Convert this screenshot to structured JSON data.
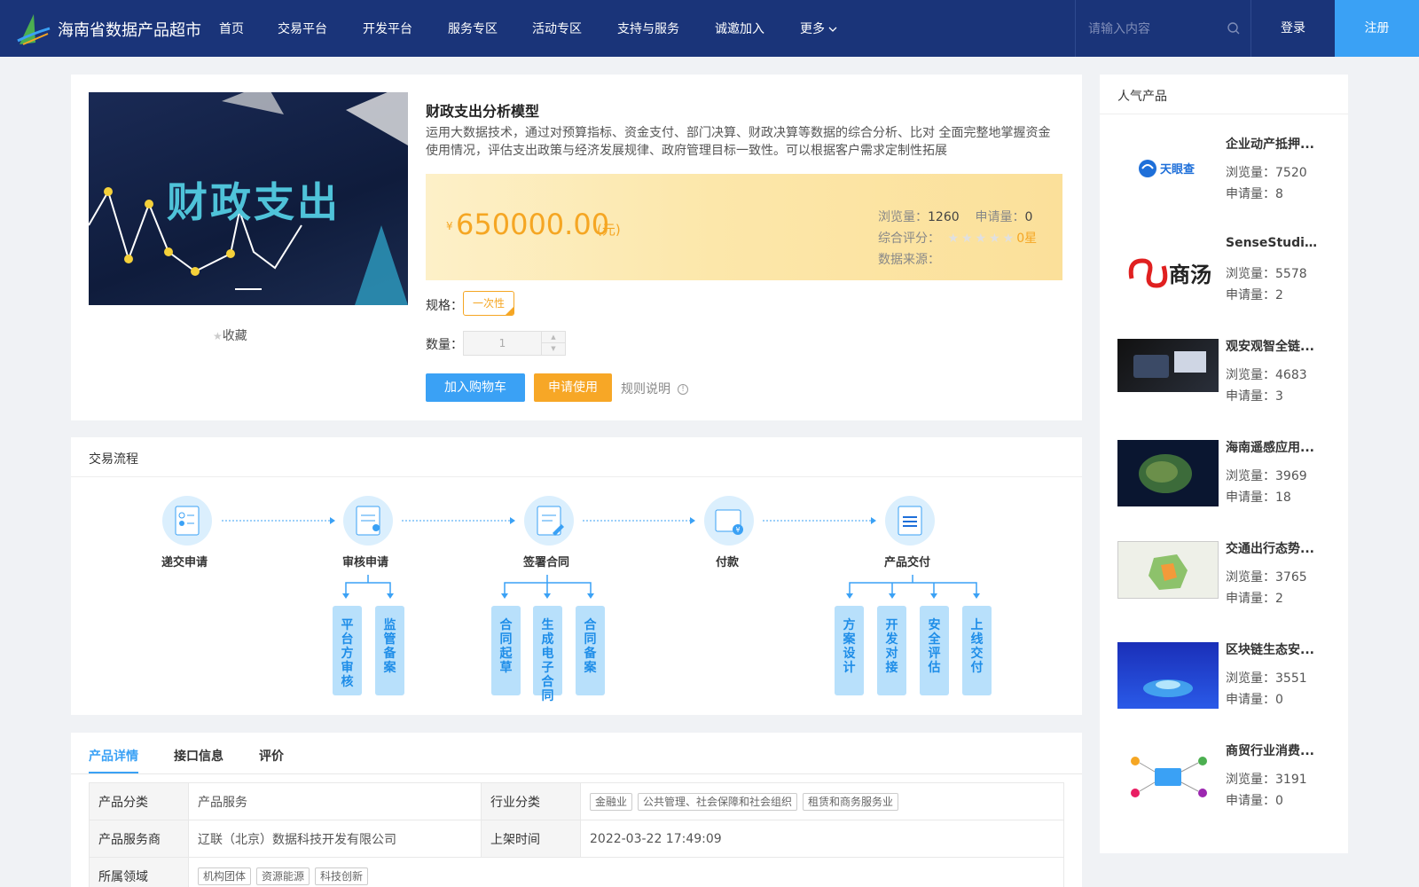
{
  "header": {
    "logo_text": "海南省数据产品超市",
    "nav": [
      "首页",
      "交易平台",
      "开发平台",
      "服务专区",
      "活动专区",
      "支持与服务",
      "诚邀加入",
      "更多"
    ],
    "search_placeholder": "请输入内容",
    "login": "登录",
    "register": "注册",
    "colors": {
      "bar": "#1a3479",
      "register": "#3aa1f5"
    }
  },
  "product": {
    "image_text": "财政支出",
    "favorite": "收藏",
    "title": "财政支出分析模型",
    "description": "运用大数据技术，通过对预算指标、资金支付、部门决算、财政决算等数据的综合分析、比对 全面完整地掌握资金使用情况，评估支出政策与经济发展规律、政府管理目标一致性。可以根据客户需求定制性拓展",
    "currency": "¥",
    "price": "650000.00",
    "price_unit": "(元)",
    "views_label": "浏览量：",
    "views": "1260",
    "applications_label": "申请量：",
    "applications": "0",
    "rating_label": "综合评分：",
    "rating_value": "0星",
    "rating_stars": 0,
    "source_label": "数据来源：",
    "spec_label": "规格：",
    "spec_option": "一次性",
    "qty_label": "数量：",
    "qty_value": "1",
    "add_to_cart": "加入购物车",
    "apply": "申请使用",
    "rules": "规则说明",
    "colors": {
      "accent": "#f5a623",
      "primary": "#3aa1f5"
    }
  },
  "process": {
    "title": "交易流程",
    "steps": [
      {
        "label": "递交申请",
        "icon": "form-icon"
      },
      {
        "label": "审核申请",
        "icon": "review-icon"
      },
      {
        "label": "签署合同",
        "icon": "contract-icon"
      },
      {
        "label": "付款",
        "icon": "payment-icon"
      },
      {
        "label": "产品交付",
        "icon": "delivery-icon"
      }
    ],
    "sub_steps": {
      "review": [
        "平台方审核",
        "监管备案"
      ],
      "contract": [
        "合同起草",
        "生成电子合同",
        "合同备案"
      ],
      "delivery": [
        "方案设计",
        "开发对接",
        "安全评估",
        "上线交付"
      ]
    }
  },
  "tabs": [
    "产品详情",
    "接口信息",
    "评价"
  ],
  "details": {
    "category_label": "产品分类",
    "category": "产品服务",
    "industry_label": "行业分类",
    "industry_tags": [
      "金融业",
      "公共管理、社会保障和社会组织",
      "租赁和商务服务业"
    ],
    "provider_label": "产品服务商",
    "provider": "辽联（北京）数据科技开发有限公司",
    "listed_label": "上架时间",
    "listed": "2022-03-22 17:49:09",
    "domain_label": "所属领域",
    "domain_tags": [
      "机构团体",
      "资源能源",
      "科技创新"
    ]
  },
  "sidebar": {
    "title": "人气产品",
    "views_label": "浏览量：",
    "apps_label": "申请量：",
    "items": [
      {
        "name": "企业动产抵押...",
        "views": "7520",
        "apps": "8",
        "logo": "天眼查"
      },
      {
        "name": "SenseStudio...",
        "views": "5578",
        "apps": "2",
        "logo": "商汤"
      },
      {
        "name": "观安观智全链...",
        "views": "4683",
        "apps": "3",
        "logo": ""
      },
      {
        "name": "海南遥感应用...",
        "views": "3969",
        "apps": "18",
        "logo": ""
      },
      {
        "name": "交通出行态势...",
        "views": "3765",
        "apps": "2",
        "logo": ""
      },
      {
        "name": "区块链生态安...",
        "views": "3551",
        "apps": "0",
        "logo": ""
      },
      {
        "name": "商贸行业消费...",
        "views": "3191",
        "apps": "0",
        "logo": ""
      }
    ]
  }
}
